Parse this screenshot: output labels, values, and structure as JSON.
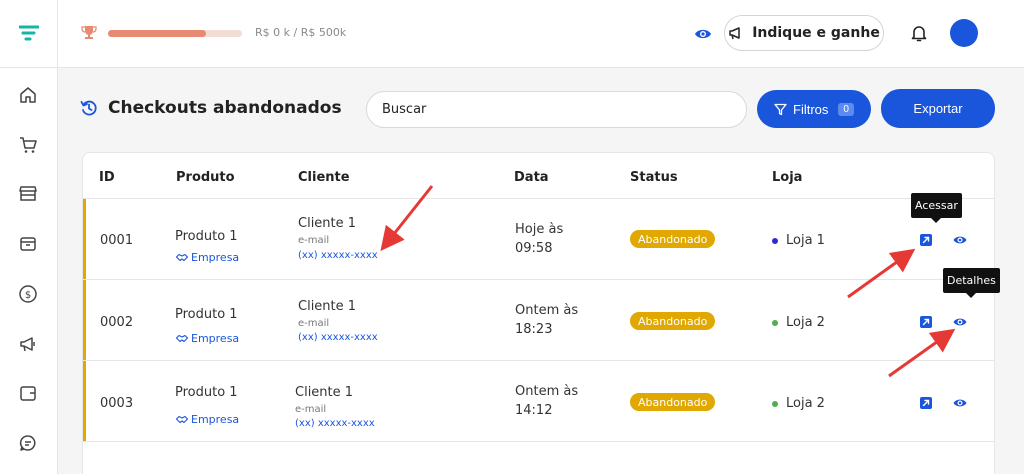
{
  "header": {
    "progress_text": "R$ 0 k / R$ 500k",
    "progress_fraction": 0.73,
    "refer_label": "Indique e ganhe"
  },
  "sidebar": {
    "items": [
      {
        "icon": "home-icon"
      },
      {
        "icon": "cart-icon"
      },
      {
        "icon": "store-icon"
      },
      {
        "icon": "box-icon"
      },
      {
        "icon": "dollar-icon"
      },
      {
        "icon": "megaphone-icon"
      },
      {
        "icon": "wallet-icon"
      },
      {
        "icon": "chat-icon"
      }
    ]
  },
  "page": {
    "title": "Checkouts abandonados",
    "search_placeholder": "Buscar",
    "filter_label": "Filtros",
    "filter_count": "0",
    "export_label": "Exportar"
  },
  "table": {
    "headers": {
      "id": "ID",
      "produto": "Produto",
      "cliente": "Cliente",
      "data": "Data",
      "status": "Status",
      "loja": "Loja"
    },
    "rows": [
      {
        "id": "0001",
        "produto": "Produto 1",
        "empresa": "Empresa",
        "cliente": "Cliente 1",
        "email": "e-mail",
        "phone": "(xx) xxxxx-xxxx",
        "data_line1": "Hoje às",
        "data_line2": "09:58",
        "status": "Abandonado",
        "loja": "Loja 1"
      },
      {
        "id": "0002",
        "produto": "Produto 1",
        "empresa": "Empresa",
        "cliente": "Cliente 1",
        "email": "e-mail",
        "phone": "(xx) xxxxx-xxxx",
        "data_line1": "Ontem às",
        "data_line2": "18:23",
        "status": "Abandonado",
        "loja": "Loja 2"
      },
      {
        "id": "0003",
        "produto": "Produto 1",
        "empresa": "Empresa",
        "cliente": "Cliente 1",
        "email": "e-mail",
        "phone": "(xx) xxxxx-xxxx",
        "data_line1": "Ontem às",
        "data_line2": "14:12",
        "status": "Abandonado",
        "loja": "Loja 2"
      }
    ]
  },
  "tooltips": {
    "acessar": "Acessar",
    "detalhes": "Detalhes"
  },
  "colors": {
    "primary": "#1a56db",
    "status_abandoned": "#e0a800",
    "loja1_dot": "#2b2bd6",
    "loja2_dot": "#4caf50",
    "annotation_arrow": "#e53935"
  }
}
